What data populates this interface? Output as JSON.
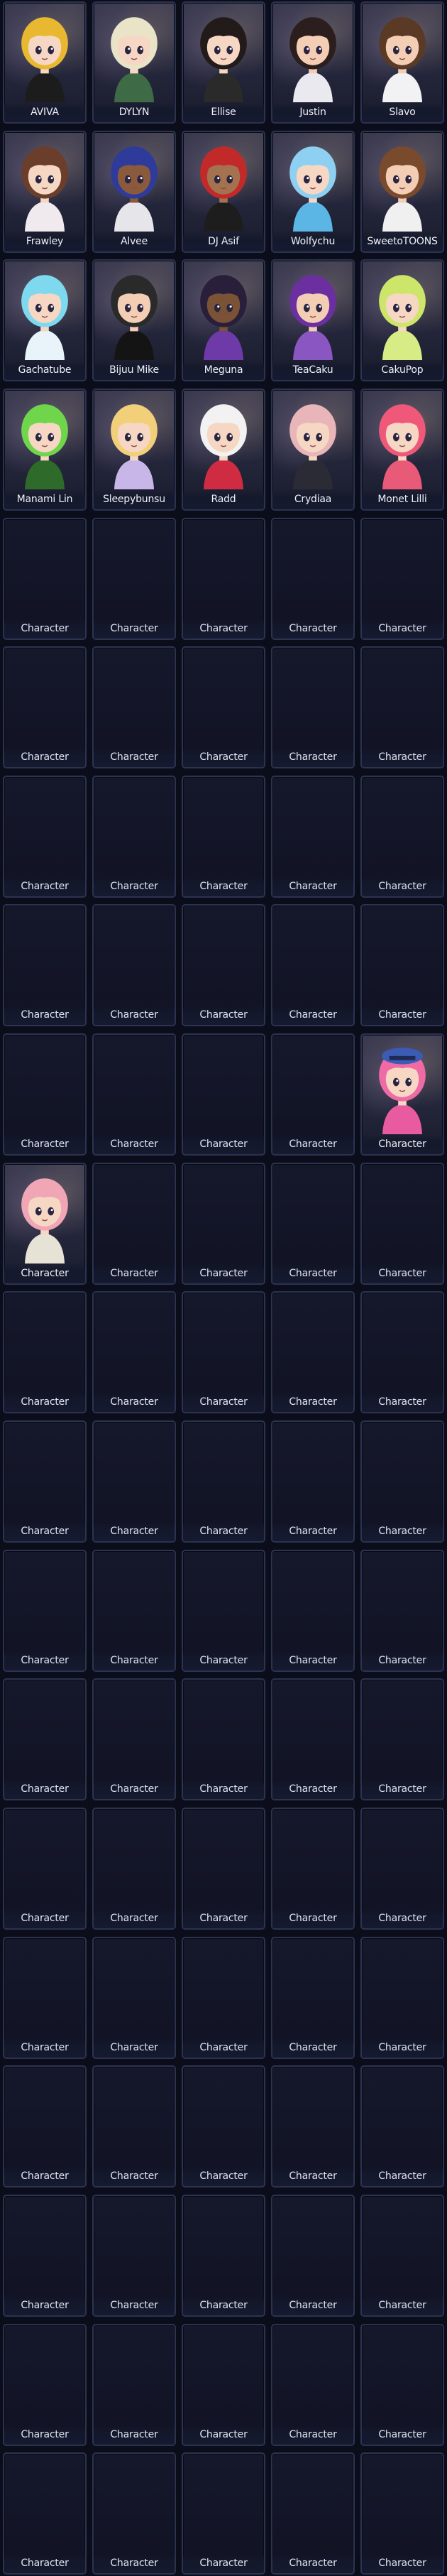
{
  "grid": {
    "columns": 5,
    "slots": [
      {
        "name": "AVIVA",
        "filled": true,
        "hair": "#e8b830",
        "skin": "#f6d7c3",
        "outfit": "#1c1c1c"
      },
      {
        "name": "DYLYN",
        "filled": true,
        "hair": "#e9e3c8",
        "skin": "#f6d7c3",
        "outfit": "#3e6a46"
      },
      {
        "name": "Ellise",
        "filled": true,
        "hair": "#231a1a",
        "skin": "#f6d7c3",
        "outfit": "#2a2a2a"
      },
      {
        "name": "Justin",
        "filled": true,
        "hair": "#2b1e1c",
        "skin": "#f3ceb4",
        "outfit": "#e9e9ef"
      },
      {
        "name": "Slavo",
        "filled": true,
        "hair": "#5a3a24",
        "skin": "#f3ceb4",
        "outfit": "#f2f2f4"
      },
      {
        "name": "Frawley",
        "filled": true,
        "hair": "#6b3e2b",
        "skin": "#f6d7c3",
        "outfit": "#f0e9ee"
      },
      {
        "name": "Alvee",
        "filled": true,
        "hair": "#2e3b9a",
        "skin": "#8a5a3c",
        "outfit": "#e6e6ea"
      },
      {
        "name": "DJ Asif",
        "filled": true,
        "hair": "#c22a2a",
        "skin": "#a5724f",
        "outfit": "#1d1d1d"
      },
      {
        "name": "Wolfychu",
        "filled": true,
        "hair": "#8ed0f2",
        "skin": "#f6d7c3",
        "outfit": "#5bb6e6"
      },
      {
        "name": "SweetoTOONS",
        "filled": true,
        "hair": "#7a4a2c",
        "skin": "#f3ceb4",
        "outfit": "#f0f0f0"
      },
      {
        "name": "Gachatube",
        "filled": true,
        "hair": "#7fd9ee",
        "skin": "#f6d7c3",
        "outfit": "#e8f4fa"
      },
      {
        "name": "Bijuu Mike",
        "filled": true,
        "hair": "#2a2a2a",
        "skin": "#f3ceb4",
        "outfit": "#141414"
      },
      {
        "name": "Meguna",
        "filled": true,
        "hair": "#2a1f3a",
        "skin": "#7a5235",
        "outfit": "#6d3aa8"
      },
      {
        "name": "TeaCaku",
        "filled": true,
        "hair": "#6b2fa0",
        "skin": "#f3ceb4",
        "outfit": "#8a56c2"
      },
      {
        "name": "CakuPop",
        "filled": true,
        "hair": "#cde66a",
        "skin": "#f6d7c3",
        "outfit": "#d8ec86"
      },
      {
        "name": "Manami Lin",
        "filled": true,
        "hair": "#6fd64c",
        "skin": "#f6d7c3",
        "outfit": "#2e6a2a"
      },
      {
        "name": "Sleepybunsu",
        "filled": true,
        "hair": "#f2d07a",
        "skin": "#f6d7c3",
        "outfit": "#c9b6e8"
      },
      {
        "name": "Radd",
        "filled": true,
        "hair": "#f2f2f2",
        "skin": "#f6d7c3",
        "outfit": "#cf2c43"
      },
      {
        "name": "Crydiaa",
        "filled": true,
        "hair": "#e8b5b8",
        "skin": "#f6d7c3",
        "outfit": "#2b2b35"
      },
      {
        "name": "Monet Lilli",
        "filled": true,
        "hair": "#f0587a",
        "skin": "#f6d7c3",
        "outfit": "#e85a78"
      },
      {
        "name": "Character",
        "filled": false
      },
      {
        "name": "Character",
        "filled": false
      },
      {
        "name": "Character",
        "filled": false
      },
      {
        "name": "Character",
        "filled": false
      },
      {
        "name": "Character",
        "filled": false
      },
      {
        "name": "Character",
        "filled": false
      },
      {
        "name": "Character",
        "filled": false
      },
      {
        "name": "Character",
        "filled": false
      },
      {
        "name": "Character",
        "filled": false
      },
      {
        "name": "Character",
        "filled": false
      },
      {
        "name": "Character",
        "filled": false
      },
      {
        "name": "Character",
        "filled": false
      },
      {
        "name": "Character",
        "filled": false
      },
      {
        "name": "Character",
        "filled": false
      },
      {
        "name": "Character",
        "filled": false
      },
      {
        "name": "Character",
        "filled": false
      },
      {
        "name": "Character",
        "filled": false
      },
      {
        "name": "Character",
        "filled": false
      },
      {
        "name": "Character",
        "filled": false
      },
      {
        "name": "Character",
        "filled": false
      },
      {
        "name": "Character",
        "filled": false
      },
      {
        "name": "Character",
        "filled": false
      },
      {
        "name": "Character",
        "filled": false
      },
      {
        "name": "Character",
        "filled": false
      },
      {
        "name": "Character",
        "filled": true,
        "hair": "#f06aa6",
        "skin": "#f6d7c3",
        "outfit": "#e85ba0",
        "hat": "#3b5bb5"
      },
      {
        "name": "Character",
        "filled": true,
        "hair": "#f1a6b6",
        "skin": "#f6d7c3",
        "outfit": "#e6e2d6"
      },
      {
        "name": "Character",
        "filled": false
      },
      {
        "name": "Character",
        "filled": false
      },
      {
        "name": "Character",
        "filled": false
      },
      {
        "name": "Character",
        "filled": false
      },
      {
        "name": "Character",
        "filled": false
      },
      {
        "name": "Character",
        "filled": false
      },
      {
        "name": "Character",
        "filled": false
      },
      {
        "name": "Character",
        "filled": false
      },
      {
        "name": "Character",
        "filled": false
      },
      {
        "name": "Character",
        "filled": false
      },
      {
        "name": "Character",
        "filled": false
      },
      {
        "name": "Character",
        "filled": false
      },
      {
        "name": "Character",
        "filled": false
      },
      {
        "name": "Character",
        "filled": false
      },
      {
        "name": "Character",
        "filled": false
      },
      {
        "name": "Character",
        "filled": false
      },
      {
        "name": "Character",
        "filled": false
      },
      {
        "name": "Character",
        "filled": false
      },
      {
        "name": "Character",
        "filled": false
      },
      {
        "name": "Character",
        "filled": false
      },
      {
        "name": "Character",
        "filled": false
      },
      {
        "name": "Character",
        "filled": false
      },
      {
        "name": "Character",
        "filled": false
      },
      {
        "name": "Character",
        "filled": false
      },
      {
        "name": "Character",
        "filled": false
      },
      {
        "name": "Character",
        "filled": false
      },
      {
        "name": "Character",
        "filled": false
      },
      {
        "name": "Character",
        "filled": false
      },
      {
        "name": "Character",
        "filled": false
      },
      {
        "name": "Character",
        "filled": false
      },
      {
        "name": "Character",
        "filled": false
      },
      {
        "name": "Character",
        "filled": false
      },
      {
        "name": "Character",
        "filled": false
      },
      {
        "name": "Character",
        "filled": false
      },
      {
        "name": "Character",
        "filled": false
      },
      {
        "name": "Character",
        "filled": false
      },
      {
        "name": "Character",
        "filled": false
      },
      {
        "name": "Character",
        "filled": false
      },
      {
        "name": "Character",
        "filled": false
      },
      {
        "name": "Character",
        "filled": false
      },
      {
        "name": "Character",
        "filled": false
      },
      {
        "name": "Character",
        "filled": false
      },
      {
        "name": "Character",
        "filled": false
      },
      {
        "name": "Character",
        "filled": false
      },
      {
        "name": "Character",
        "filled": false
      },
      {
        "name": "Character",
        "filled": false
      },
      {
        "name": "Character",
        "filled": false
      },
      {
        "name": "Character",
        "filled": false
      },
      {
        "name": "Character",
        "filled": false
      },
      {
        "name": "Character",
        "filled": false
      },
      {
        "name": "Character",
        "filled": false
      },
      {
        "name": "Character",
        "filled": false
      },
      {
        "name": "Character",
        "filled": false
      },
      {
        "name": "Character",
        "filled": false
      }
    ]
  }
}
